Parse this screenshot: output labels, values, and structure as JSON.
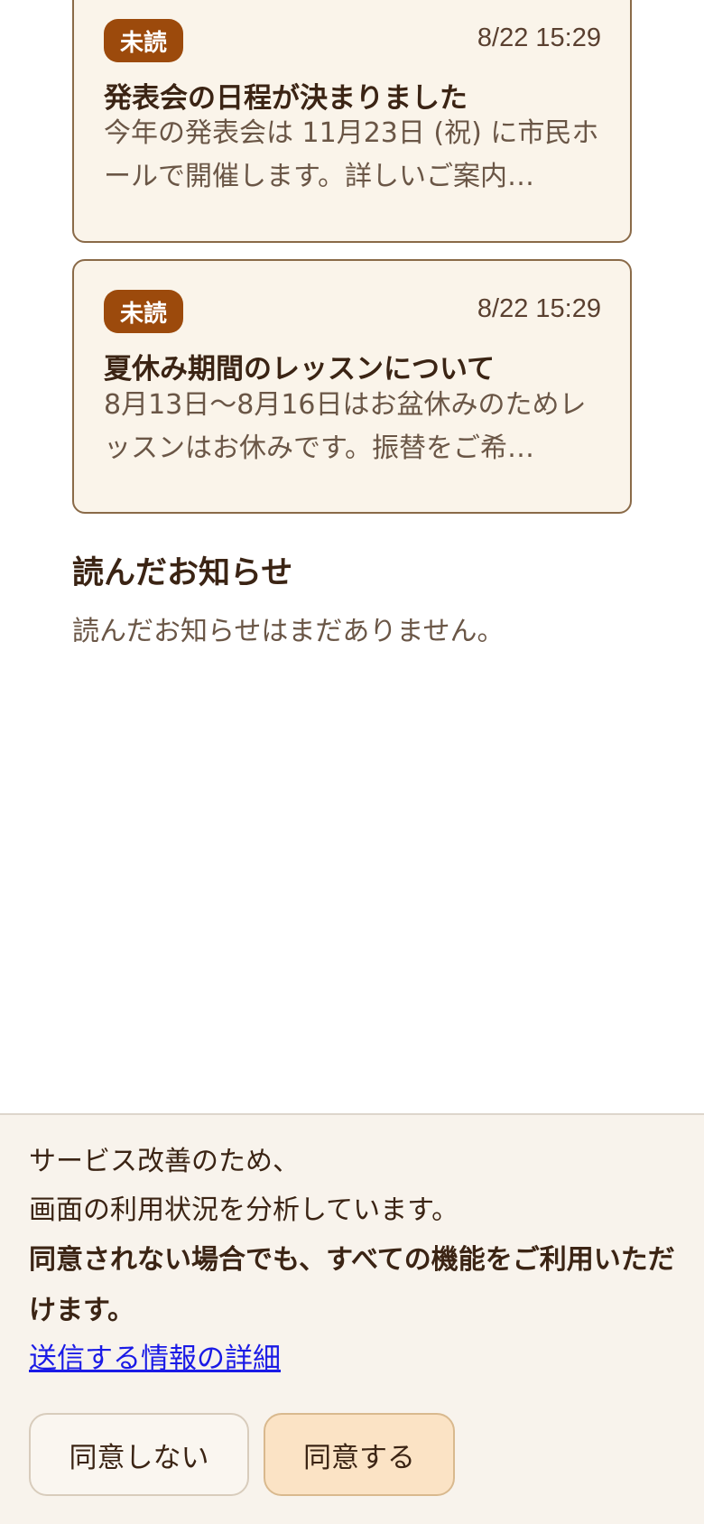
{
  "unread_notices": [
    {
      "badge": "未読",
      "time": "8/22 15:29",
      "title": "発表会の日程が決まりました",
      "body": "今年の発表会は 11月23日 (祝) に市民ホールで開催します。詳しいご案内…"
    },
    {
      "badge": "未読",
      "time": "8/22 15:29",
      "title": "夏休み期間のレッスンについて",
      "body": "8月13日〜8月16日はお盆休みのためレッスンはお休みです。振替をご希…"
    }
  ],
  "read_section": {
    "title": "読んだお知らせ",
    "empty_message": "読んだお知らせはまだありません。"
  },
  "consent_banner": {
    "line1": "サービス改善のため、",
    "line2": "画面の利用状況を分析しています。",
    "bold_note": "同意されない場合でも、すべての機能をご利用いただけます。",
    "details_link": "送信する情報の詳細",
    "decline_label": "同意しない",
    "agree_label": "同意する"
  },
  "colors": {
    "badge_bg": "#9c4a0c",
    "card_bg": "#faf4ea",
    "card_border": "#8a6a48",
    "agree_bg": "#fbe3c5",
    "link": "#1a1ae6"
  }
}
